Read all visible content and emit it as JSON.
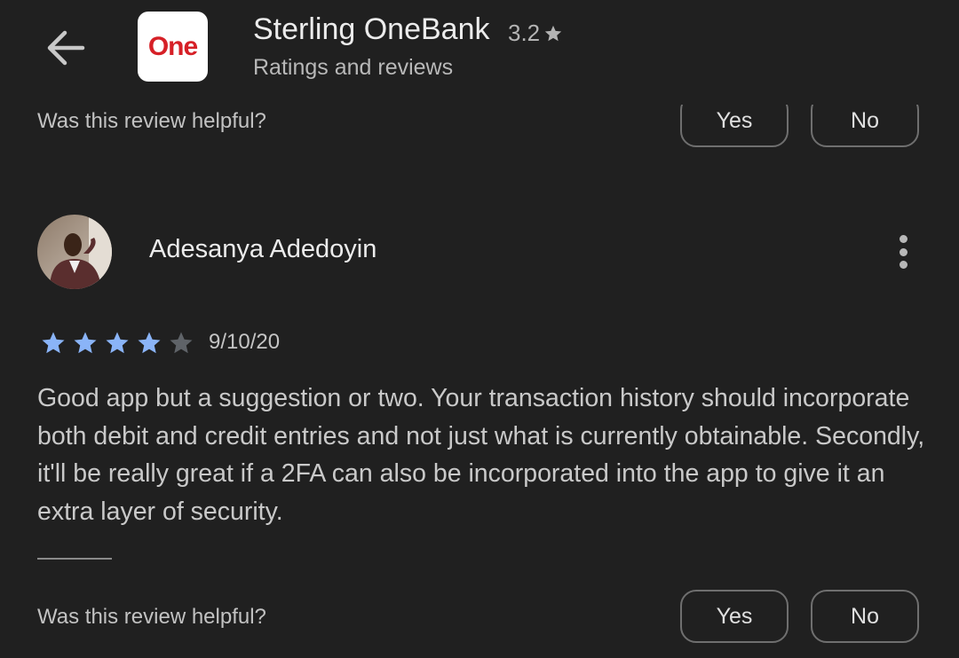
{
  "header": {
    "back_icon": "arrow-left-icon",
    "app_icon_text": "One",
    "app_name": "Sterling OneBank",
    "rating": "3.2",
    "rating_icon": "star-icon",
    "subtitle": "Ratings and reviews"
  },
  "previous_review": {
    "helpful_prompt": "Was this review helpful?",
    "yes_label": "Yes",
    "no_label": "No"
  },
  "review": {
    "reviewer_name": "Adesanya Adedoyin",
    "avatar_icon": "user-photo",
    "more_icon": "more-vertical-icon",
    "stars": 4,
    "max_stars": 5,
    "date": "9/10/20",
    "text": "Good app but a suggestion or two. Your transaction history should incorporate both debit and credit entries and not just what is currently obtainable. Secondly, it'll be really great if a 2FA can also be incorporated into the app to give it an extra layer of security.",
    "helpful_prompt": "Was this review helpful?",
    "yes_label": "Yes",
    "no_label": "No"
  },
  "colors": {
    "background": "#202020",
    "star_filled": "#8ab4f8",
    "star_empty": "#5f6368",
    "brand_red": "#d62027"
  }
}
